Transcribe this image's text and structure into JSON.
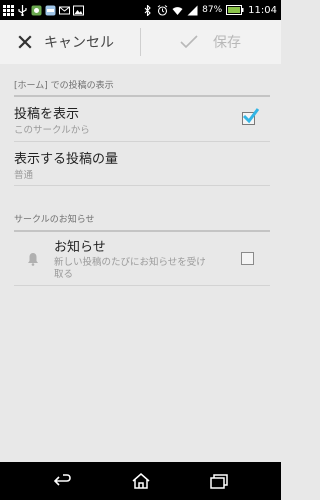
{
  "status_bar": {
    "battery_percent": "87%",
    "time": "11:04",
    "notification_icons": [
      "grid-icon",
      "usb-icon",
      "app-icon",
      "counter-icon",
      "mail-icon",
      "image-icon"
    ],
    "status_icons": [
      "bluetooth-icon",
      "alarm-icon",
      "wifi-icon",
      "signal-icon",
      "battery-icon"
    ]
  },
  "action_bar": {
    "cancel_label": "キャンセル",
    "save_label": "保存"
  },
  "sections": [
    {
      "header": "[ホーム] での投稿の表示",
      "items": [
        {
          "title": "投稿を表示",
          "subtitle": "このサークルから",
          "checked": true
        },
        {
          "title": "表示する投稿の量",
          "subtitle": "普通"
        }
      ]
    },
    {
      "header": "サークルのお知らせ",
      "items": [
        {
          "title": "お知らせ",
          "subtitle_line1": "新しい投稿のたびにお知らせを受け",
          "subtitle_line2": "取る",
          "checked": false,
          "icon": "bell-icon"
        }
      ]
    }
  ],
  "nav_bar": {
    "buttons": [
      "back-icon",
      "home-icon",
      "recents-icon"
    ]
  },
  "colors": {
    "accent": "#33b5e5",
    "background": "#e8e8e8",
    "action_bar": "#f2f2f2"
  }
}
